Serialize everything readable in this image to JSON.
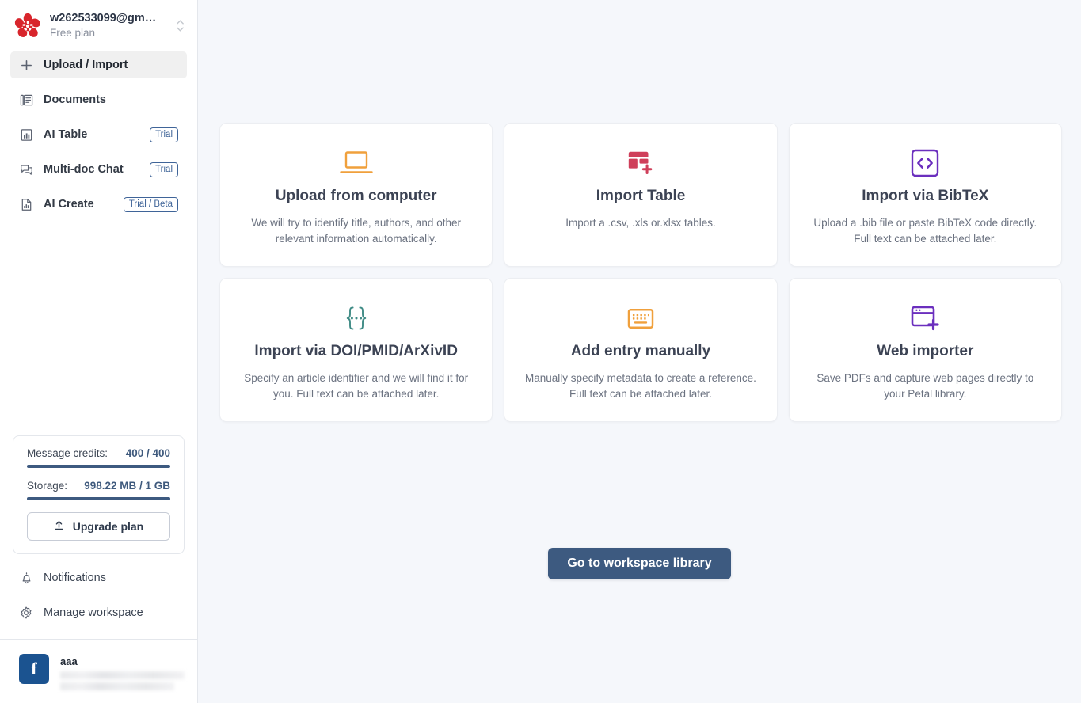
{
  "sidebar": {
    "workspace": {
      "name": "w262533099@gm…",
      "plan": "Free plan",
      "logo_icon": "petal-flower-logo",
      "switch_icon": "chevron-up-down-icon"
    },
    "nav": [
      {
        "label": "Upload / Import",
        "icon": "plus-icon",
        "active": true,
        "badge": ""
      },
      {
        "label": "Documents",
        "icon": "documents-icon",
        "active": false,
        "badge": ""
      },
      {
        "label": "AI Table",
        "icon": "table-chart-icon",
        "active": false,
        "badge": "Trial"
      },
      {
        "label": "Multi-doc Chat",
        "icon": "chat-bubbles-icon",
        "active": false,
        "badge": "Trial"
      },
      {
        "label": "AI Create",
        "icon": "document-chart-icon",
        "active": false,
        "badge": "Trial / Beta"
      }
    ],
    "usage": {
      "credits_label": "Message credits:",
      "credits_value": "400 / 400",
      "credits_percent": 100,
      "storage_label": "Storage:",
      "storage_value": "998.22 MB / 1 GB",
      "storage_percent": 100,
      "upgrade_label": "Upgrade plan",
      "upgrade_icon": "upload-arrow-icon"
    },
    "footer_nav": [
      {
        "label": "Notifications",
        "icon": "bell-icon"
      },
      {
        "label": "Manage workspace",
        "icon": "gear-icon"
      }
    ],
    "user": {
      "name": "aaa",
      "avatar_icon": "facebook-icon",
      "avatar_letter": "f",
      "detail_redacted": true
    }
  },
  "main": {
    "cards": [
      {
        "title": "Upload from computer",
        "desc": "We will try to identify title, authors, and other relevant information automatically.",
        "icon": "laptop-icon",
        "color": "#f0a03c"
      },
      {
        "title": "Import Table",
        "desc": "Import a .csv, .xls or.xlsx tables.",
        "icon": "table-plus-icon",
        "color": "#cf3f5a"
      },
      {
        "title": "Import via BibTeX",
        "desc": "Upload a .bib file or paste BibTeX code directly. Full text can be attached later.",
        "icon": "code-brackets-icon",
        "color": "#6b2fbe"
      },
      {
        "title": "Import via DOI/PMID/ArXivID",
        "desc": "Specify an article identifier and we will find it for you. Full text can be attached later.",
        "icon": "curly-braces-icon",
        "color": "#3f8b85"
      },
      {
        "title": "Add entry manually",
        "desc": "Manually specify metadata to create a reference. Full text can be attached later.",
        "icon": "keyboard-icon",
        "color": "#f0a03c"
      },
      {
        "title": "Web importer",
        "desc": "Save PDFs and capture web pages directly to your Petal library.",
        "icon": "browser-plus-icon",
        "color": "#6b2fbe"
      }
    ],
    "cta_label": "Go to workspace library"
  },
  "colors": {
    "accent": "#3d5a80",
    "canvas": "#f5f7fb",
    "brand_red": "#d8252c",
    "badge_blue": "#3f6498"
  }
}
